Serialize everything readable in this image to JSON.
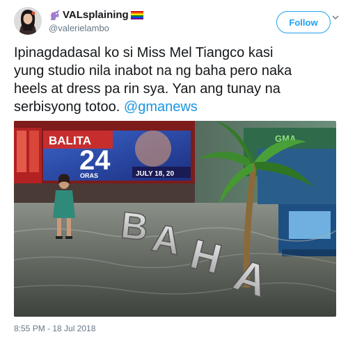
{
  "tweet": {
    "display_name": "VALsplaining",
    "handle": "@valerielambo",
    "follow_label": "Follow",
    "text_line_1": "Ipinagdadasal ko si Miss Mel Tiangco kasi",
    "text_line_2": "yung studio nila inabot na ng baha pero naka",
    "text_line_3": "heels at dress pa rin sya. Yan ang tunay na",
    "text_line_4_prefix": "serbisyong totoo.",
    "mention": "@gmanews",
    "timestamp": "8:55 PM - 18 Jul 2018",
    "icons": [
      "unicorn-icon",
      "rainbow-flag-icon",
      "caret-down-icon"
    ],
    "accent_color": "#1da1f2"
  },
  "media": {
    "screen_brand_top": "BALITA",
    "screen_number": "24",
    "screen_brand_bottom": "ORAS",
    "screen_date": "JULY 18, 20",
    "logo_text": "GMA",
    "baha_letters": [
      "B",
      "A",
      "H",
      "A"
    ]
  }
}
